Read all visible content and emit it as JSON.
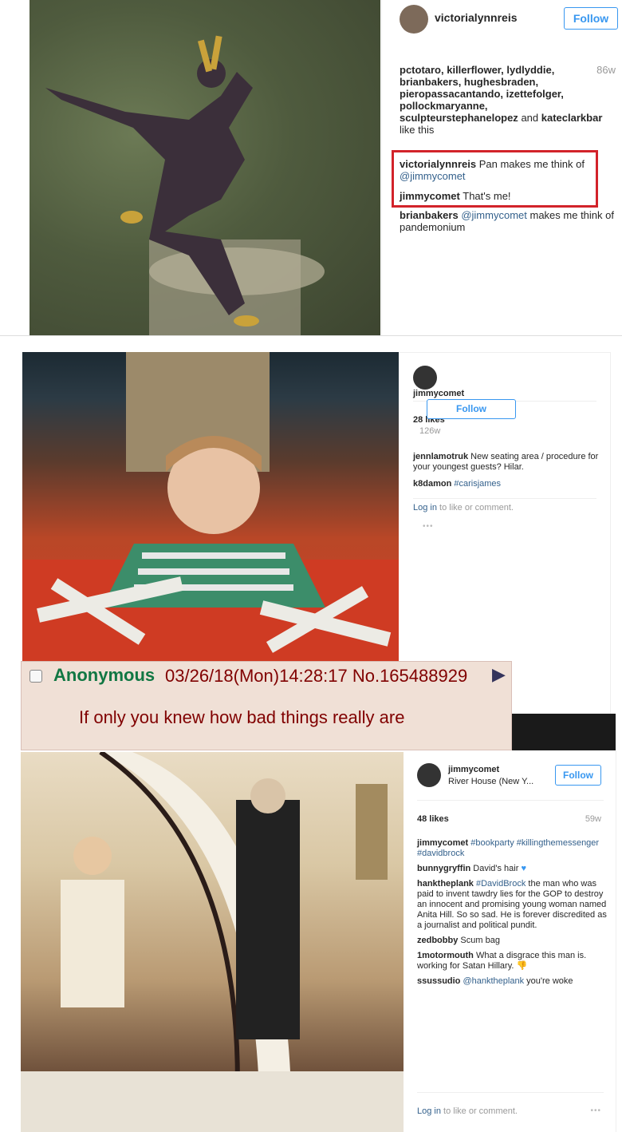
{
  "panel1": {
    "username": "victorialynnreis",
    "follow_label": "Follow",
    "likes_text": "pctotaro, killerflower, lydlyddie, brianbakers, hughesbraden, pieropassacantando, izettefolger, pollockmaryanne, sculpteurstephanelopez",
    "likes_and": "and",
    "likes_last": "kateclarkbar",
    "likes_suffix": "like this",
    "time": "86w",
    "comments": [
      {
        "user": "victorialynnreis",
        "text": "Pan makes me think of",
        "mention": "@jimmycomet"
      },
      {
        "user": "jimmycomet",
        "text": "That's me!"
      },
      {
        "user": "brianbakers",
        "mention": "@jimmycomet",
        "text": "makes me think of pandemonium"
      }
    ]
  },
  "panel2": {
    "username": "jimmycomet",
    "follow_label": "Follow",
    "likes": "28 likes",
    "time": "126w",
    "comments": [
      {
        "user": "jennlamotruk",
        "text": "New seating area / procedure for your youngest guests? Hilar."
      },
      {
        "user": "k8damon",
        "hashtag": "#carisjames"
      }
    ],
    "login_link": "Log in",
    "login_text": "to like or comment.",
    "more": "•••"
  },
  "chan_post": {
    "name": "Anonymous",
    "datetime": "03/26/18(Mon)14:28:17 No.165488929",
    "arrow": "▶",
    "message": "If only you knew how bad things really are"
  },
  "panel3": {
    "username": "jimmycomet",
    "location": "River House (New Y...",
    "follow_label": "Follow",
    "likes": "48 likes",
    "time": "59w",
    "comments": [
      {
        "user": "jimmycomet",
        "tags": "#bookparty #killingthemessenger #davidbrock"
      },
      {
        "user": "bunnygryffin",
        "text": "David's hair",
        "emoji": "♥"
      },
      {
        "user": "hanktheplank",
        "tag": "#DavidBrock",
        "text": "the man who was paid to invent tawdry lies for the GOP to destroy an innocent and promising young woman named Anita Hill. So so sad. He is forever discredited as a journalist and political pundit."
      },
      {
        "user": "zedbobby",
        "text": "Scum bag"
      },
      {
        "user": "1motormouth",
        "text": "What a disgrace this man is. working for Satan Hillary.",
        "emoji": "👎"
      },
      {
        "user": "ssussudio",
        "mention": "@hanktheplank",
        "text": "you're woke"
      }
    ],
    "login_link": "Log in",
    "login_text": "to like or comment.",
    "more": "•••"
  },
  "colors": {
    "link_blue": "#3897f0",
    "hashtag": "#34618c",
    "highlight_red": "#d2232a",
    "chan_green": "#117743",
    "chan_maroon": "#800000",
    "chan_bg": "#f0e0d6"
  }
}
